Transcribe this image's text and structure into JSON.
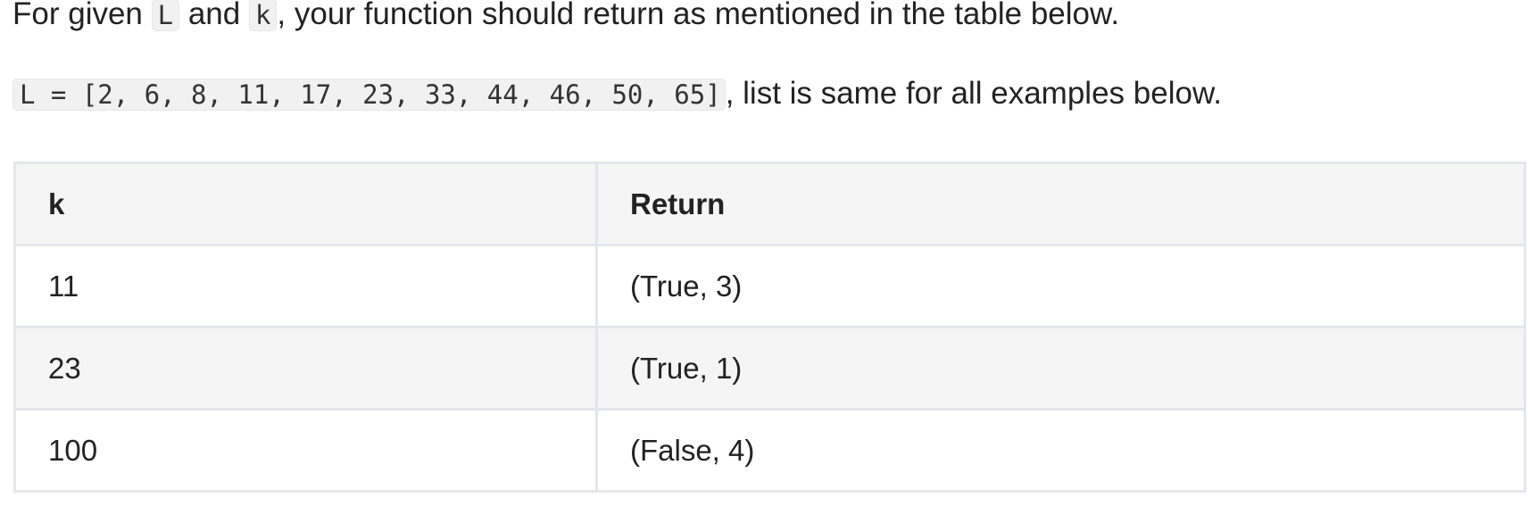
{
  "intro": {
    "part1": "For given ",
    "code_L": "L",
    "part2": " and ",
    "code_k": "k",
    "part3": ", your function should return as mentioned in the table below."
  },
  "list_line": {
    "code": "L = [2, 6, 8, 11, 17, 23, 33, 44, 46, 50, 65]",
    "text": ", list is same for all examples below."
  },
  "table": {
    "headers": [
      "k",
      "Return"
    ],
    "rows": [
      [
        "11",
        "(True, 3)"
      ],
      [
        "23",
        "(True, 1)"
      ],
      [
        "100",
        "(False, 4)"
      ]
    ]
  }
}
